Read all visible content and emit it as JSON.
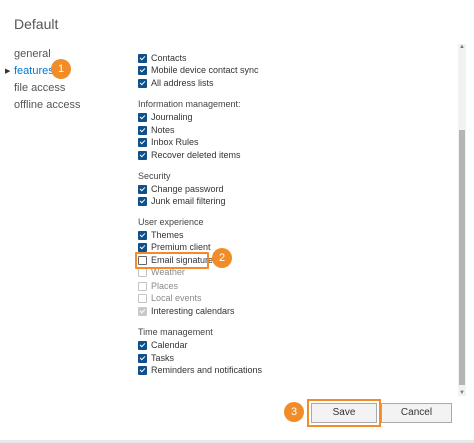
{
  "window": {
    "title": "Default"
  },
  "nav": {
    "items": [
      {
        "label": "general"
      },
      {
        "label": "features"
      },
      {
        "label": "file access"
      },
      {
        "label": "offline access"
      }
    ]
  },
  "callouts": [
    "1",
    "2",
    "3"
  ],
  "features": {
    "top_items": [
      {
        "label": "Contacts",
        "state": "checked"
      },
      {
        "label": "Mobile device contact sync",
        "state": "checked"
      },
      {
        "label": "All address lists",
        "state": "checked"
      }
    ],
    "info_mgmt": {
      "title": "Information management:",
      "items": [
        {
          "label": "Journaling",
          "state": "checked"
        },
        {
          "label": "Notes",
          "state": "checked"
        },
        {
          "label": "Inbox Rules",
          "state": "checked"
        },
        {
          "label": "Recover deleted items",
          "state": "checked"
        }
      ]
    },
    "security": {
      "title": "Security",
      "items": [
        {
          "label": "Change password",
          "state": "checked"
        },
        {
          "label": "Junk email filtering",
          "state": "checked"
        }
      ]
    },
    "user_experience": {
      "title": "User experience",
      "items": [
        {
          "label": "Themes",
          "state": "checked"
        },
        {
          "label": "Premium client",
          "state": "checked"
        },
        {
          "label": "Email signature",
          "state": "unchecked"
        },
        {
          "label": "Weather",
          "state": "disabled"
        },
        {
          "label": "Places",
          "state": "disabled"
        },
        {
          "label": "Local events",
          "state": "disabled"
        },
        {
          "label": "Interesting calendars",
          "state": "disabled-checked"
        }
      ]
    },
    "time_mgmt": {
      "title": "Time management",
      "items": [
        {
          "label": "Calendar",
          "state": "checked"
        },
        {
          "label": "Tasks",
          "state": "checked"
        },
        {
          "label": "Reminders and notifications",
          "state": "checked"
        }
      ]
    }
  },
  "buttons": {
    "save": "Save",
    "cancel": "Cancel"
  },
  "colors": {
    "accent": "#0078d4",
    "checkbox": "#0f4f8a",
    "callout": "#f28c28"
  }
}
